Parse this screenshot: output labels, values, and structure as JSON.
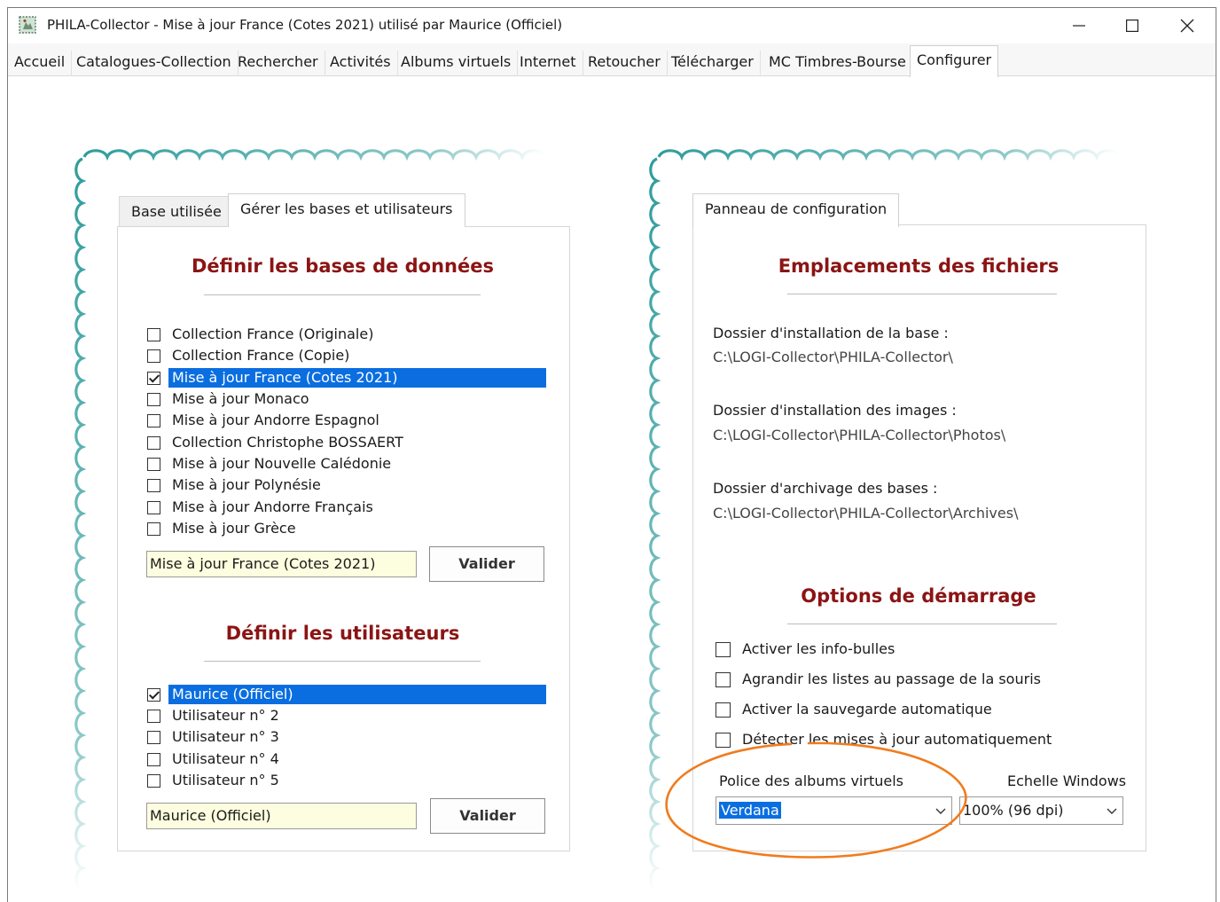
{
  "window": {
    "title": "PHILA-Collector - Mise à jour France (Cotes 2021) utilisé par Maurice (Officiel)",
    "icon": "stamp-app-icon",
    "controls": {
      "minimize": "minimize-icon",
      "maximize": "maximize-icon",
      "close": "close-icon"
    }
  },
  "menubar": {
    "tabs": [
      {
        "label": "Accueil"
      },
      {
        "label": "Catalogues-Collection"
      },
      {
        "label": "Rechercher"
      },
      {
        "label": "Activités"
      },
      {
        "label": "Albums virtuels"
      },
      {
        "label": "Internet"
      },
      {
        "label": "Retoucher"
      },
      {
        "label": "Télécharger"
      },
      {
        "label": "MC Timbres-Bourse"
      },
      {
        "label": "Configurer",
        "active": true
      }
    ]
  },
  "left_panel": {
    "tabs": [
      {
        "label": "Base utilisée",
        "active": false
      },
      {
        "label": "Gérer les bases et utilisateurs",
        "active": true
      }
    ],
    "databases": {
      "title": "Définir les bases de données",
      "items": [
        {
          "label": "Collection France (Originale)",
          "checked": false,
          "selected": false
        },
        {
          "label": "Collection France (Copie)",
          "checked": false,
          "selected": false
        },
        {
          "label": "Mise à jour France (Cotes 2021)",
          "checked": true,
          "selected": true
        },
        {
          "label": "Mise à jour Monaco",
          "checked": false,
          "selected": false
        },
        {
          "label": "Mise à jour Andorre Espagnol",
          "checked": false,
          "selected": false
        },
        {
          "label": "Collection Christophe BOSSAERT",
          "checked": false,
          "selected": false
        },
        {
          "label": "Mise à jour Nouvelle Calédonie",
          "checked": false,
          "selected": false
        },
        {
          "label": "Mise à jour Polynésie",
          "checked": false,
          "selected": false
        },
        {
          "label": "Mise à jour Andorre Français",
          "checked": false,
          "selected": false
        },
        {
          "label": "Mise à jour Grèce",
          "checked": false,
          "selected": false
        }
      ],
      "name_value": "Mise à jour France (Cotes 2021)",
      "validate_label": "Valider"
    },
    "users": {
      "title": "Définir les utilisateurs",
      "items": [
        {
          "label": "Maurice (Officiel)",
          "checked": true,
          "selected": true
        },
        {
          "label": "Utilisateur n° 2",
          "checked": false,
          "selected": false
        },
        {
          "label": "Utilisateur n° 3",
          "checked": false,
          "selected": false
        },
        {
          "label": "Utilisateur n° 4",
          "checked": false,
          "selected": false
        },
        {
          "label": "Utilisateur n° 5",
          "checked": false,
          "selected": false
        }
      ],
      "name_value": "Maurice (Officiel)",
      "validate_label": "Valider"
    }
  },
  "right_panel": {
    "tab_label": "Panneau de configuration",
    "files": {
      "title": "Emplacements des fichiers",
      "install_label": "Dossier d'installation de la base :",
      "install_path": "C:\\LOGI-Collector\\PHILA-Collector\\",
      "images_label": "Dossier d'installation des images :",
      "images_path": "C:\\LOGI-Collector\\PHILA-Collector\\Photos\\",
      "archive_label": "Dossier d'archivage des bases :",
      "archive_path": "C:\\LOGI-Collector\\PHILA-Collector\\Archives\\"
    },
    "startup": {
      "title": "Options de démarrage",
      "options": [
        {
          "label": "Activer les info-bulles",
          "checked": false
        },
        {
          "label": "Agrandir les listes au passage de la souris",
          "checked": false
        },
        {
          "label": "Activer la sauvegarde automatique",
          "checked": false
        },
        {
          "label": "Détecter les mises à jour automatiquement",
          "checked": false
        }
      ],
      "font_label": "Police des albums virtuels",
      "font_value": "Verdana",
      "scale_label": "Echelle Windows",
      "scale_value": "100% (96 dpi)"
    }
  },
  "colors": {
    "section_title": "#8b1414",
    "selection": "#0a6ee0",
    "stamp_edge": "#2f9c9c",
    "input_bg": "#fdfde0",
    "highlight": "#f07c1e"
  }
}
